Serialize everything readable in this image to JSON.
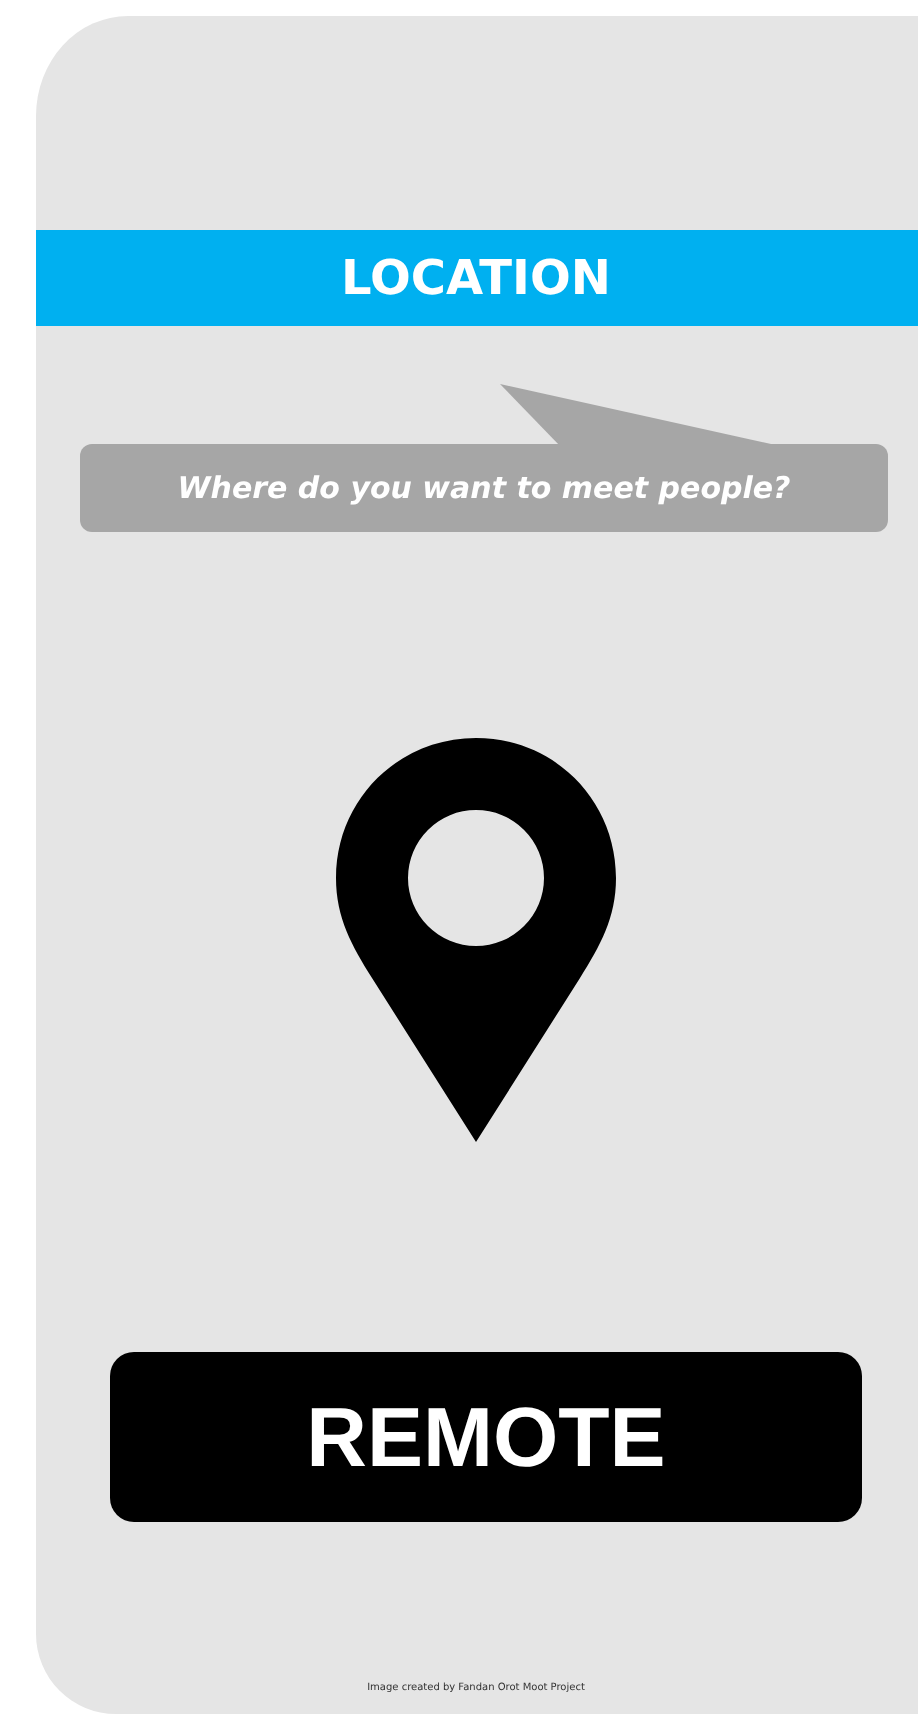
{
  "header": {
    "title": "LOCATION"
  },
  "prompt": {
    "text": "Where do you want to meet people?"
  },
  "button": {
    "label": "REMOTE"
  },
  "footer": {
    "text": "Image created by Fandan Orot Moot Project"
  }
}
